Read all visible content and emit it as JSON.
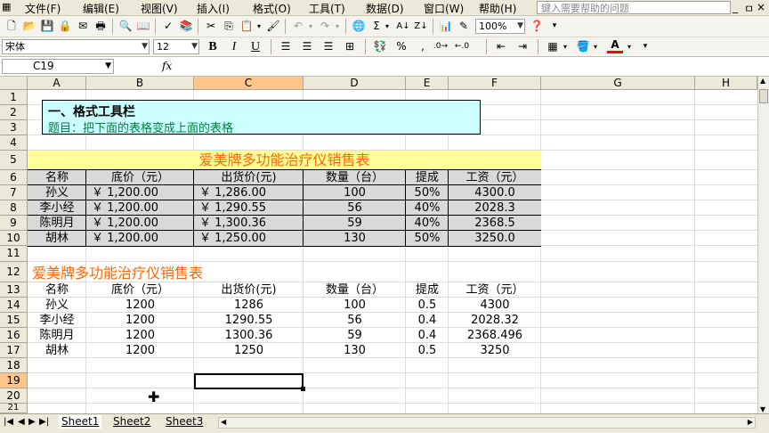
{
  "menu": {
    "items": [
      "文件(F)",
      "编辑(E)",
      "视图(V)",
      "插入(I)",
      "格式(O)",
      "工具(T)",
      "数据(D)",
      "窗口(W)",
      "帮助(H)"
    ],
    "help_placeholder": "键入需要帮助的问题",
    "window_controls": [
      "_",
      "ㅁ",
      "×"
    ]
  },
  "toolbar": {
    "zoom": "100%",
    "font_name": "宋体",
    "font_size": "12",
    "bold": "B",
    "italic": "I",
    "underline": "U",
    "percent": "%",
    "comma": ","
  },
  "formula_bar": {
    "cell_ref": "C19",
    "fx": "fx"
  },
  "columns": [
    "A",
    "B",
    "C",
    "D",
    "E",
    "F",
    "G",
    "H"
  ],
  "rows": [
    "1",
    "2",
    "3",
    "4",
    "5",
    "6",
    "7",
    "8",
    "9",
    "10",
    "11",
    "12",
    "13",
    "14",
    "15",
    "16",
    "17",
    "18",
    "19",
    "20",
    "21"
  ],
  "title_box": {
    "line1": "一、格式工具栏",
    "line2": "题目：把下面的表格变成上面的表格"
  },
  "formatted_table": {
    "title": "爱美牌多功能治疗仪销售表",
    "headers": [
      "名称",
      "底价（元）",
      "出货价(元)",
      "数量（台）",
      "提成",
      "工资（元）"
    ],
    "rows": [
      [
        "孙义",
        "￥ 1,200.00",
        "￥ 1,286.00",
        "100",
        "50%",
        "4300.0"
      ],
      [
        "李小经",
        "￥ 1,200.00",
        "￥ 1,290.55",
        "56",
        "40%",
        "2028.3"
      ],
      [
        "陈明月",
        "￥ 1,200.00",
        "￥ 1,300.36",
        "59",
        "40%",
        "2368.5"
      ],
      [
        "胡林",
        "￥ 1,200.00",
        "￥ 1,250.00",
        "130",
        "50%",
        "3250.0"
      ]
    ]
  },
  "plain_table": {
    "title": "爱美牌多功能治疗仪销售表",
    "headers": [
      "名称",
      "底价（元）",
      "出货价(元)",
      "数量（台）",
      "提成",
      "工资（元）"
    ],
    "rows": [
      [
        "孙义",
        "1200",
        "1286",
        "100",
        "0.5",
        "4300"
      ],
      [
        "李小经",
        "1200",
        "1290.55",
        "56",
        "0.4",
        "2028.32"
      ],
      [
        "陈明月",
        "1200",
        "1300.36",
        "59",
        "0.4",
        "2368.496"
      ],
      [
        "胡林",
        "1200",
        "1250",
        "130",
        "0.5",
        "3250"
      ]
    ]
  },
  "sheets": [
    "Sheet1",
    "Sheet2",
    "Sheet3"
  ],
  "colors": {
    "title_box_bg": "#ccffff",
    "formatted_title_bg": "#ffff99",
    "title_text": "#ff6600",
    "subtitle_text": "#008040",
    "row_fill": "#d9d9d9"
  }
}
